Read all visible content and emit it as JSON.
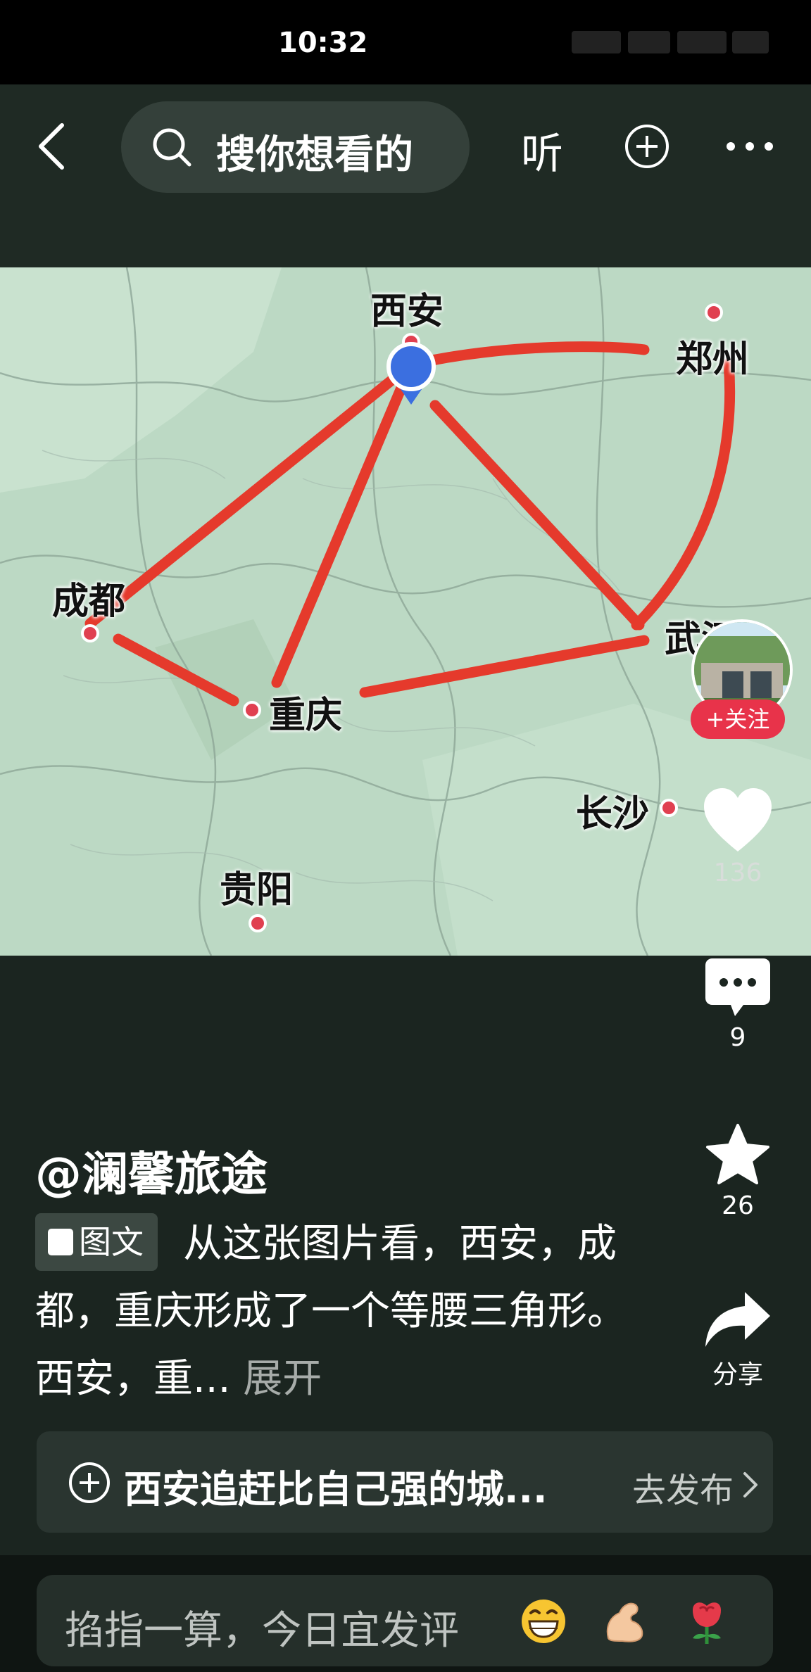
{
  "status_bar": {
    "time": "10:32"
  },
  "top_bar": {
    "search_placeholder": "搜你想看的",
    "listen_label": "听"
  },
  "map": {
    "cities": [
      {
        "name": "西安"
      },
      {
        "name": "郑州"
      },
      {
        "name": "成都"
      },
      {
        "name": "重庆"
      },
      {
        "name": "武汉"
      },
      {
        "name": "长沙"
      },
      {
        "name": "贵阳"
      }
    ],
    "route_color": "#e53a2c"
  },
  "follow": {
    "label": "+关注"
  },
  "actions": {
    "like_count": "136",
    "comment_count": "9",
    "favorite_count": "26",
    "share_label": "分享"
  },
  "post": {
    "author": "@澜馨旅途",
    "tag": "图文",
    "caption": "从这张图片看，西安，成都，重庆形成了一个等腰三角形。西安，重...",
    "expand": "展开"
  },
  "topic": {
    "text": "西安追赶比自己强的城...",
    "publish": "去发布"
  },
  "comment": {
    "placeholder": "掐指一算，今日宜发评"
  }
}
